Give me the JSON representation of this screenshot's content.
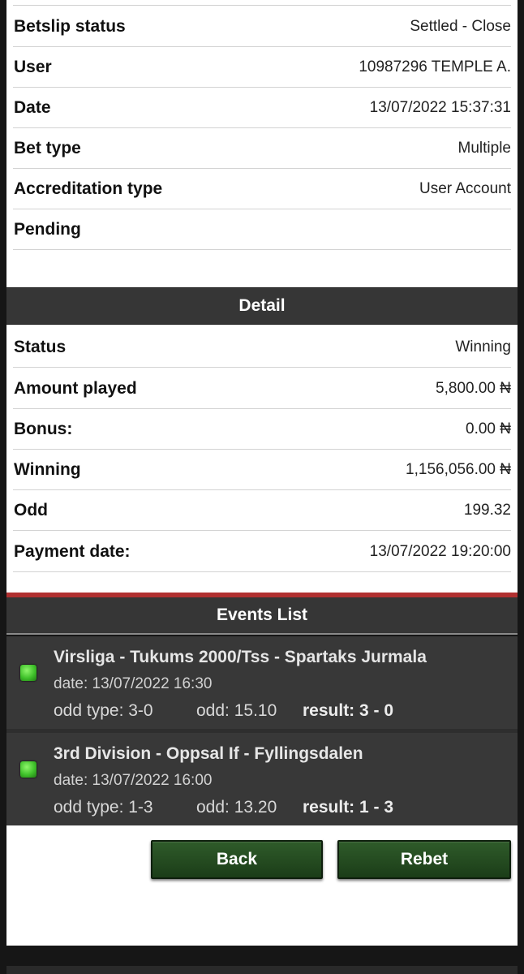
{
  "betslip_info": {
    "rows": [
      {
        "label": "Betslip status",
        "value": "Settled - Close"
      },
      {
        "label": "User",
        "value": "10987296 TEMPLE A."
      },
      {
        "label": "Date",
        "value": "13/07/2022 15:37:31"
      },
      {
        "label": "Bet type",
        "value": "Multiple"
      },
      {
        "label": "Accreditation type",
        "value": "User Account"
      },
      {
        "label": "Pending",
        "value": ""
      }
    ]
  },
  "detail": {
    "title": "Detail",
    "rows": [
      {
        "label": "Status",
        "value": "Winning"
      },
      {
        "label": "Amount played",
        "value": "5,800.00 ₦"
      },
      {
        "label": "Bonus:",
        "value": "0.00 ₦"
      },
      {
        "label": "Winning",
        "value": "1,156,056.00 ₦"
      },
      {
        "label": "Odd",
        "value": "199.32"
      },
      {
        "label": "Payment date:",
        "value": "13/07/2022 19:20:00"
      }
    ]
  },
  "events": {
    "title": "Events List",
    "status_color": "#3fc12a",
    "items": [
      {
        "title": "Virsliga - Tukums 2000/Tss - Spartaks Jurmala",
        "date": "date: 13/07/2022 16:30",
        "odd_type": "odd type: 3-0",
        "odd": "odd: 15.10",
        "result": "result: 3 - 0"
      },
      {
        "title": "3rd Division - Oppsal If - Fyllingsdalen",
        "date": "date: 13/07/2022 16:00",
        "odd_type": "odd type: 1-3",
        "odd": "odd: 13.20",
        "result": "result: 1 - 3"
      }
    ]
  },
  "actions": {
    "back_label": "Back",
    "rebet_label": "Rebet"
  },
  "colors": {
    "header_bg": "#363636",
    "accent_red": "#b03030",
    "button_green": "#2f5b2a"
  }
}
